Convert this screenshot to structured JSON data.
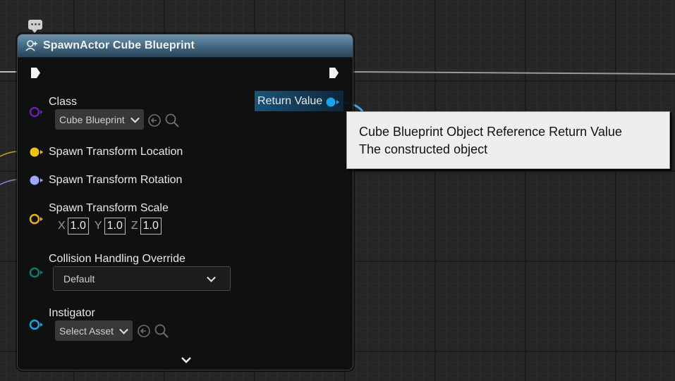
{
  "node": {
    "title": "SpawnActor Cube Blueprint",
    "class_label": "Class",
    "class_value": "Cube Blueprint",
    "location_label": "Spawn Transform Location",
    "rotation_label": "Spawn Transform Rotation",
    "scale_label": "Spawn Transform Scale",
    "scale": {
      "x_label": "X",
      "x": "1.0",
      "y_label": "Y",
      "y": "1.0",
      "z_label": "Z",
      "z": "1.0"
    },
    "collision_label": "Collision Handling Override",
    "collision_value": "Default",
    "instigator_label": "Instigator",
    "instigator_value": "Select Asset",
    "return_label": "Return Value"
  },
  "tooltip": {
    "line1": "Cube Blueprint Object Reference Return Value",
    "line2": "The constructed object"
  },
  "colors": {
    "class_pin": "#6a1fa8",
    "location_pin": "#f2c116",
    "rotation_pin": "#9ea8ff",
    "scale_pin": "#e4b21d",
    "collision_pin": "#0e7a70",
    "instigator_pin": "#1aa3e8",
    "return_pin": "#1aa3e8",
    "header": "#4a6f8a"
  }
}
